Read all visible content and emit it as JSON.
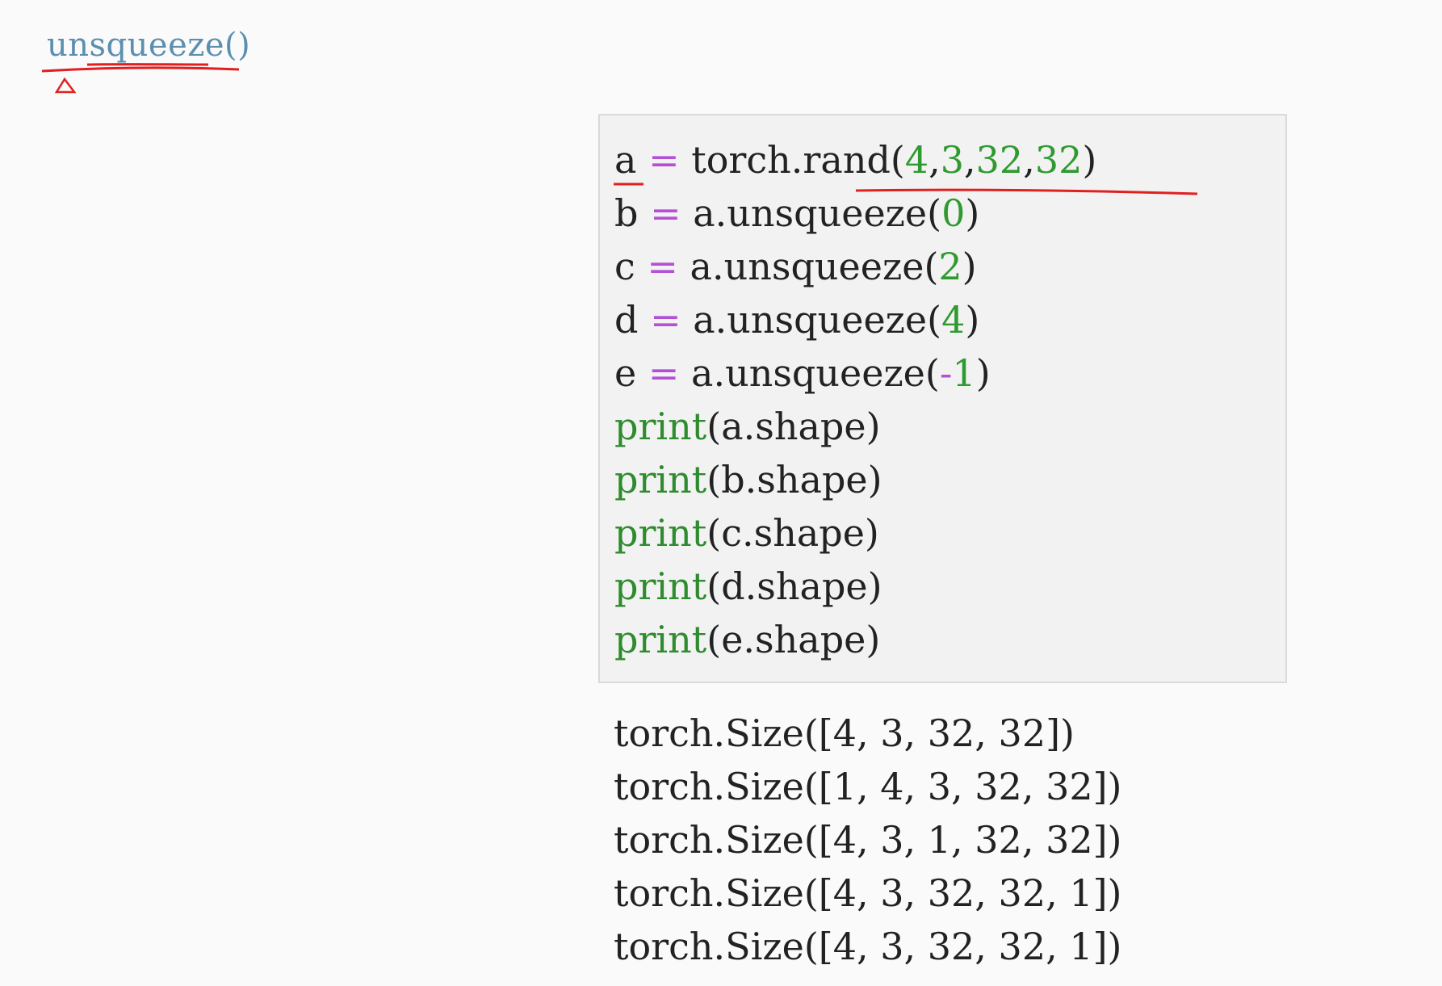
{
  "heading": {
    "text": "unsqueeze",
    "parens": "()"
  },
  "code_cell": {
    "lines": [
      {
        "tokens": [
          {
            "t": "a",
            "c": "text"
          },
          {
            "t": " ",
            "c": "text"
          },
          {
            "t": "=",
            "c": "op"
          },
          {
            "t": " torch.rand(",
            "c": "text"
          },
          {
            "t": "4",
            "c": "num"
          },
          {
            "t": ",",
            "c": "text"
          },
          {
            "t": "3",
            "c": "num"
          },
          {
            "t": ",",
            "c": "text"
          },
          {
            "t": "32",
            "c": "num"
          },
          {
            "t": ",",
            "c": "text"
          },
          {
            "t": "32",
            "c": "num"
          },
          {
            "t": ")",
            "c": "text"
          }
        ]
      },
      {
        "tokens": [
          {
            "t": "b ",
            "c": "text"
          },
          {
            "t": "=",
            "c": "op"
          },
          {
            "t": " a.unsqueeze(",
            "c": "text"
          },
          {
            "t": "0",
            "c": "num"
          },
          {
            "t": ")",
            "c": "text"
          }
        ]
      },
      {
        "tokens": [
          {
            "t": "c ",
            "c": "text"
          },
          {
            "t": "=",
            "c": "op"
          },
          {
            "t": " a.unsqueeze(",
            "c": "text"
          },
          {
            "t": "2",
            "c": "num"
          },
          {
            "t": ")",
            "c": "text"
          }
        ]
      },
      {
        "tokens": [
          {
            "t": "d ",
            "c": "text"
          },
          {
            "t": "=",
            "c": "op"
          },
          {
            "t": " a.unsqueeze(",
            "c": "text"
          },
          {
            "t": "4",
            "c": "num"
          },
          {
            "t": ")",
            "c": "text"
          }
        ]
      },
      {
        "tokens": [
          {
            "t": "e ",
            "c": "text"
          },
          {
            "t": "=",
            "c": "op"
          },
          {
            "t": " a.unsqueeze(",
            "c": "text"
          },
          {
            "t": "-",
            "c": "op"
          },
          {
            "t": "1",
            "c": "num"
          },
          {
            "t": ")",
            "c": "text"
          }
        ]
      },
      {
        "tokens": [
          {
            "t": "print",
            "c": "kw"
          },
          {
            "t": "(a.shape)",
            "c": "text"
          }
        ]
      },
      {
        "tokens": [
          {
            "t": "print",
            "c": "kw"
          },
          {
            "t": "(b.shape)",
            "c": "text"
          }
        ]
      },
      {
        "tokens": [
          {
            "t": "print",
            "c": "kw"
          },
          {
            "t": "(c.shape)",
            "c": "text"
          }
        ]
      },
      {
        "tokens": [
          {
            "t": "print",
            "c": "kw"
          },
          {
            "t": "(d.shape)",
            "c": "text"
          }
        ]
      },
      {
        "tokens": [
          {
            "t": "print",
            "c": "kw"
          },
          {
            "t": "(e.shape)",
            "c": "text"
          }
        ]
      }
    ]
  },
  "output": {
    "lines": [
      "torch.Size([4, 3, 32, 32])",
      "torch.Size([1, 4, 3, 32, 32])",
      "torch.Size([4, 3, 1, 32, 32])",
      "torch.Size([4, 3, 32, 32, 1])",
      "torch.Size([4, 3, 32, 32, 1])"
    ]
  },
  "colors": {
    "operator": "#b44fd6",
    "number": "#2f9a2f",
    "keyword": "#2e8b2e",
    "heading": "#5b8fb0",
    "annotation": "#e02020"
  }
}
